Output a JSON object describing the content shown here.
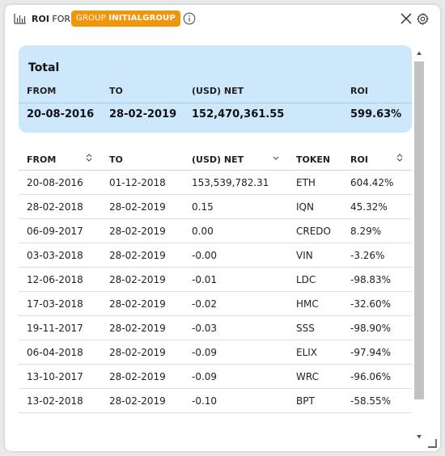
{
  "header": {
    "title_bold": "ROI",
    "title_rest": "FOR",
    "group_badge_prefix": "GROUP",
    "group_badge_name": "INITIALGROUP",
    "icons": [
      "bar-chart-icon",
      "info-icon",
      "close-icon",
      "gear-icon"
    ]
  },
  "total": {
    "title": "Total",
    "headers": {
      "from": "FROM",
      "to": "TO",
      "net": "(USD) NET",
      "roi": "ROI"
    },
    "values": {
      "from": "20-08-2016",
      "to": "28-02-2019",
      "net": "152,470,361.55",
      "roi": "599.63%"
    }
  },
  "table": {
    "headers": {
      "from": "FROM",
      "to": "TO",
      "net": "(USD) NET",
      "token": "TOKEN",
      "roi": "ROI"
    },
    "rows": [
      {
        "from": "20-08-2016",
        "to": "01-12-2018",
        "net": "153,539,782.31",
        "token": "ETH",
        "roi": "604.42%"
      },
      {
        "from": "28-02-2018",
        "to": "28-02-2019",
        "net": "0.15",
        "token": "IQN",
        "roi": "45.32%"
      },
      {
        "from": "06-09-2017",
        "to": "28-02-2019",
        "net": "0.00",
        "token": "CREDO",
        "roi": "8.29%"
      },
      {
        "from": "03-03-2018",
        "to": "28-02-2019",
        "net": "-0.00",
        "token": "VIN",
        "roi": "-3.26%"
      },
      {
        "from": "12-06-2018",
        "to": "28-02-2019",
        "net": "-0.01",
        "token": "LDC",
        "roi": "-98.83%"
      },
      {
        "from": "17-03-2018",
        "to": "28-02-2019",
        "net": "-0.02",
        "token": "HMC",
        "roi": "-32.60%"
      },
      {
        "from": "19-11-2017",
        "to": "28-02-2019",
        "net": "-0.03",
        "token": "SSS",
        "roi": "-98.90%"
      },
      {
        "from": "06-04-2018",
        "to": "28-02-2019",
        "net": "-0.09",
        "token": "ELIX",
        "roi": "-97.94%"
      },
      {
        "from": "13-10-2017",
        "to": "28-02-2019",
        "net": "-0.09",
        "token": "WRC",
        "roi": "-96.06%"
      },
      {
        "from": "13-02-2018",
        "to": "28-02-2019",
        "net": "-0.10",
        "token": "BPT",
        "roi": "-58.55%"
      }
    ]
  },
  "colors": {
    "group_badge": "#f0960d",
    "total_box_bg": "#cde8fa",
    "scrollbar_thumb": "#c2c2c2"
  }
}
